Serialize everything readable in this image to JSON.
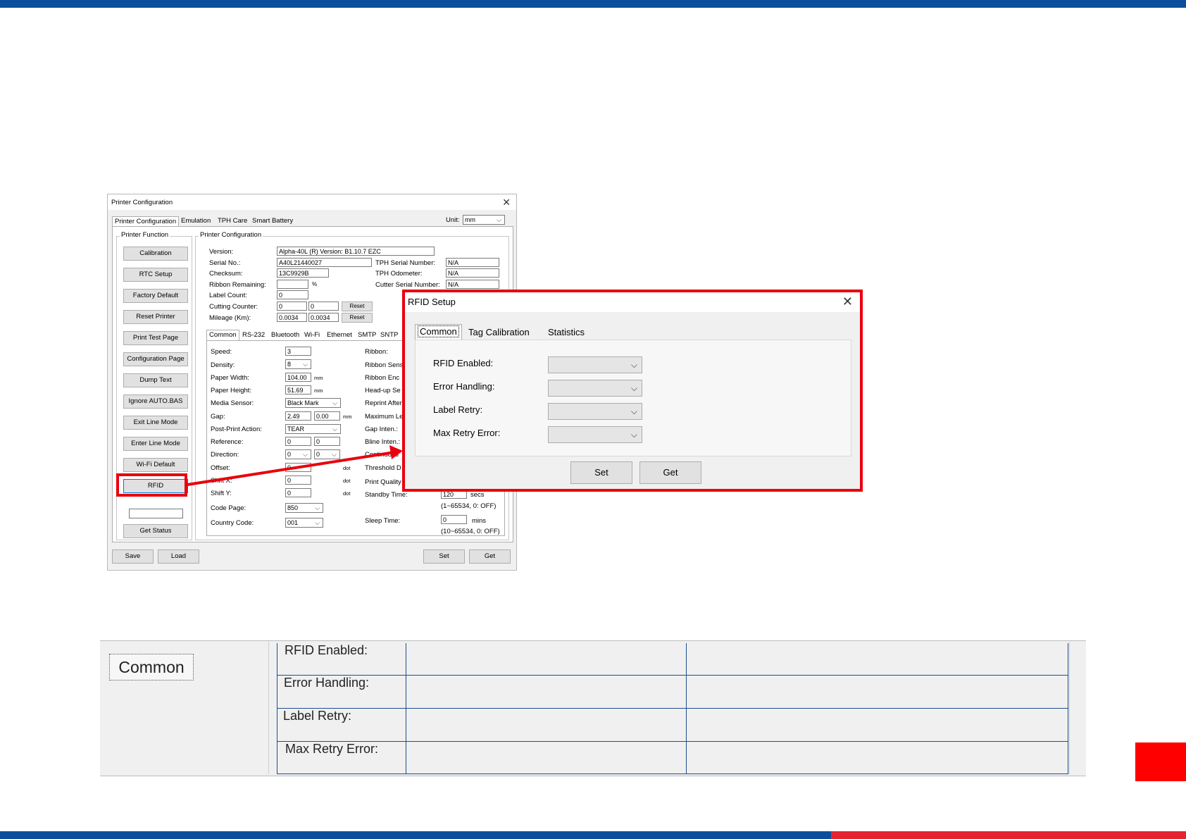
{
  "win": {
    "title": "Printer Configuration",
    "tabs": [
      "Printer Configuration",
      "Emulation",
      "TPH Care",
      "Smart Battery"
    ],
    "unit_label": "Unit:",
    "unit_value": "mm",
    "printer_function_legend": "Printer Function",
    "function_buttons": [
      "Calibration",
      "RTC Setup",
      "Factory Default",
      "Reset Printer",
      "Print Test Page",
      "Configuration Page",
      "Dump Text",
      "Ignore AUTO.BAS",
      "Exit Line Mode",
      "Enter Line Mode",
      "Wi-Fi Default",
      "RFID"
    ],
    "get_status": "Get Status",
    "printer_config_legend": "Printer Configuration",
    "info": {
      "version_label": "Version:",
      "version_value": "Alpha-40L (R) Version: B1.10.7 EZC",
      "serial_label": "Serial No.:",
      "serial_value": "A40L21440027",
      "checksum_label": "Checksum:",
      "checksum_value": "13C9929B",
      "ribbon_label": "Ribbon Remaining:",
      "ribbon_unit": "%",
      "labelcount_label": "Label Count:",
      "labelcount_value": "0",
      "cutting_label": "Cutting Counter:",
      "cutting_value1": "0",
      "cutting_value2": "0",
      "mileage_label": "Mileage (Km):",
      "mileage_value1": "0.0034",
      "mileage_value2": "0.0034",
      "reset": "Reset",
      "tph_serial_label": "TPH Serial Number:",
      "tph_serial_value": "N/A",
      "tph_odo_label": "TPH Odometer:",
      "tph_odo_value": "N/A",
      "cutter_serial_label": "Cutter Serial Number:",
      "cutter_serial_value": "N/A"
    },
    "subtabs": [
      "Common",
      "RS-232",
      "Bluetooth",
      "Wi-Fi",
      "Ethernet",
      "SMTP",
      "SNTP"
    ],
    "common": {
      "speed_label": "Speed:",
      "speed_value": "3",
      "density_label": "Density:",
      "density_value": "8",
      "pw_label": "Paper Width:",
      "pw_value": "104.00",
      "mm": "mm",
      "ph_label": "Paper Height:",
      "ph_value": "51.69",
      "ms_label": "Media Sensor:",
      "ms_value": "Black Mark",
      "gap_label": "Gap:",
      "gap_value1": "2.49",
      "gap_value2": "0.00",
      "ppa_label": "Post-Print Action:",
      "ppa_value": "TEAR",
      "ref_label": "Reference:",
      "ref_value1": "0",
      "ref_value2": "0",
      "dir_label": "Direction:",
      "dir_value1": "0",
      "dir_value2": "0",
      "offset_label": "Offset:",
      "offset_value": "0",
      "shiftx_label": "Shift X:",
      "shiftx_value": "0",
      "shifty_label": "Shift Y:",
      "shifty_value": "0",
      "dot": "dot",
      "codepage_label": "Code Page:",
      "codepage_value": "850",
      "country_label": "Country Code:",
      "country_value": "001",
      "ribbon_label": "Ribbon:",
      "ribbon_sens_label": "Ribbon Sens",
      "ribbon_enc_label": "Ribbon Enc",
      "headup_label": "Head-up Se",
      "reprint_label": "Reprint After",
      "maxlen_label": "Maximum Le",
      "gapinten_label": "Gap Inten.:",
      "blineinten_label": "Bline Inten.:",
      "continuous_label": "Continuous",
      "threshold_label": "Threshold D",
      "pq_label": "Print Quality",
      "standby_label": "Standby Time:",
      "standby_value": "120",
      "secs": "secs",
      "standby_range": "(1~65534, 0: OFF)",
      "sleep_label": "Sleep Time:",
      "sleep_value": "0",
      "mins": "mins",
      "sleep_range": "(10~65534, 0: OFF)"
    },
    "bottom_buttons": {
      "save": "Save",
      "load": "Load",
      "set": "Set",
      "get": "Get"
    }
  },
  "rfid_dialog": {
    "title": "RFID Setup",
    "tabs": [
      "Common",
      "Tag Calibration",
      "Statistics"
    ],
    "fields": [
      "RFID Enabled:",
      "Error Handling:",
      "Label Retry:",
      "Max Retry Error:"
    ],
    "set": "Set",
    "get": "Get"
  },
  "table": {
    "common_label": "Common",
    "rows": [
      "RFID Enabled:",
      "Error Handling:",
      "Label Retry:",
      "Max Retry Error:"
    ]
  }
}
